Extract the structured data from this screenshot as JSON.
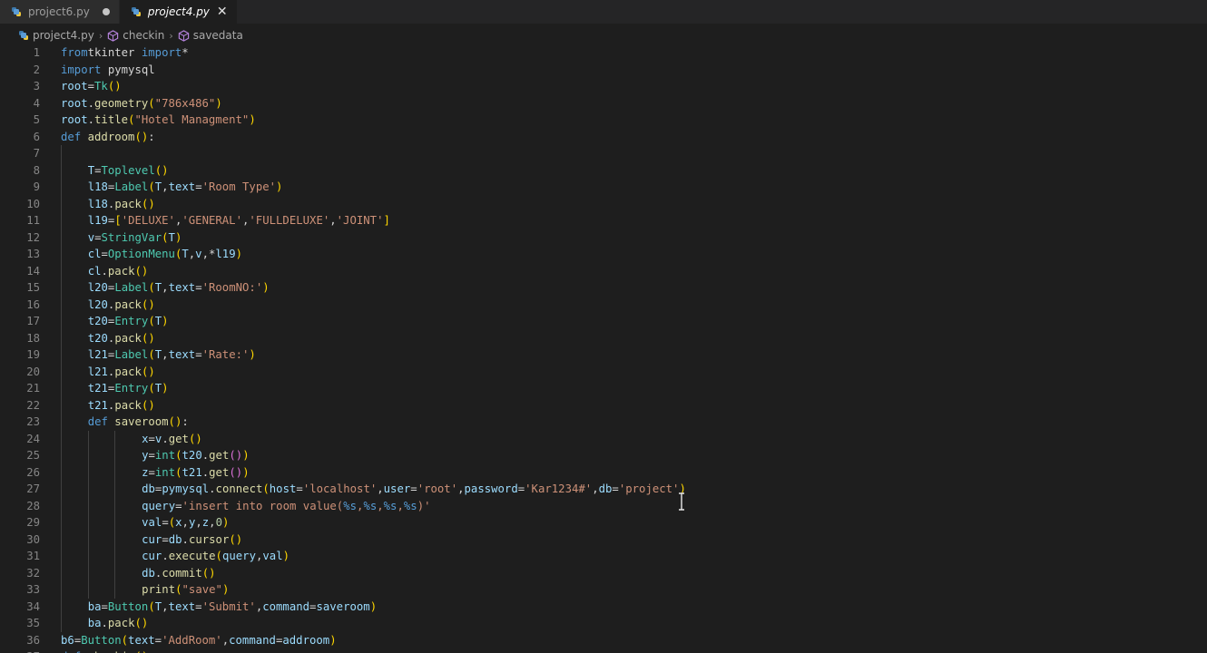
{
  "tabs": [
    {
      "label": "project6.py",
      "active": false,
      "modified": true
    },
    {
      "label": "project4.py",
      "active": true,
      "modified": false
    }
  ],
  "breadcrumb": {
    "file": "project4.py",
    "symbol1": "checkin",
    "symbol2": "savedata"
  },
  "colors": {
    "background": "#1e1e1e",
    "keyword": "#569cd6",
    "string": "#ce9178",
    "function": "#dcdcaa",
    "class": "#4ec9b0"
  },
  "editor": {
    "lines": [
      {
        "n": "1",
        "indent": 0,
        "tokens": [
          [
            "kw",
            "from"
          ],
          [
            "",
            "tkinter"
          ],
          [
            "kw",
            " import"
          ],
          [
            "",
            "*"
          ]
        ]
      },
      {
        "n": "2",
        "indent": 0,
        "tokens": [
          [
            "kw",
            "import"
          ],
          [
            "",
            " pymysql"
          ]
        ]
      },
      {
        "n": "3",
        "indent": 0,
        "tokens": [
          [
            "var",
            "root"
          ],
          [
            "",
            "="
          ],
          [
            "cls",
            "Tk"
          ],
          [
            "br1",
            "()"
          ]
        ]
      },
      {
        "n": "4",
        "indent": 0,
        "tokens": [
          [
            "var",
            "root"
          ],
          [
            "",
            "."
          ],
          [
            "fn",
            "geometry"
          ],
          [
            "br1",
            "("
          ],
          [
            "str",
            "\"786x486\""
          ],
          [
            "br1",
            ")"
          ]
        ]
      },
      {
        "n": "5",
        "indent": 0,
        "tokens": [
          [
            "var",
            "root"
          ],
          [
            "",
            "."
          ],
          [
            "fn",
            "title"
          ],
          [
            "br1",
            "("
          ],
          [
            "str",
            "\"Hotel Managment\""
          ],
          [
            "br1",
            ")"
          ]
        ]
      },
      {
        "n": "6",
        "indent": 0,
        "tokens": [
          [
            "kw",
            "def"
          ],
          [
            "fn",
            " addroom"
          ],
          [
            "br1",
            "()"
          ],
          [
            "",
            ":"
          ]
        ]
      },
      {
        "n": "7",
        "indent": 1,
        "tokens": []
      },
      {
        "n": "8",
        "indent": 1,
        "tokens": [
          [
            "var",
            "T"
          ],
          [
            "",
            "="
          ],
          [
            "cls",
            "Toplevel"
          ],
          [
            "br1",
            "()"
          ]
        ]
      },
      {
        "n": "9",
        "indent": 1,
        "tokens": [
          [
            "var",
            "l18"
          ],
          [
            "",
            "="
          ],
          [
            "cls",
            "Label"
          ],
          [
            "br1",
            "("
          ],
          [
            "var",
            "T"
          ],
          [
            "",
            ","
          ],
          [
            "var",
            "text"
          ],
          [
            "",
            "="
          ],
          [
            "str",
            "'Room Type'"
          ],
          [
            "br1",
            ")"
          ]
        ]
      },
      {
        "n": "10",
        "indent": 1,
        "tokens": [
          [
            "var",
            "l18"
          ],
          [
            "",
            "."
          ],
          [
            "fn",
            "pack"
          ],
          [
            "br1",
            "()"
          ]
        ]
      },
      {
        "n": "11",
        "indent": 1,
        "tokens": [
          [
            "var",
            "l19"
          ],
          [
            "",
            "="
          ],
          [
            "br1",
            "["
          ],
          [
            "str",
            "'DELUXE'"
          ],
          [
            "",
            ","
          ],
          [
            "str",
            "'GENERAL'"
          ],
          [
            "",
            ","
          ],
          [
            "str",
            "'FULLDELUXE'"
          ],
          [
            "",
            ","
          ],
          [
            "str",
            "'JOINT'"
          ],
          [
            "br1",
            "]"
          ]
        ]
      },
      {
        "n": "12",
        "indent": 1,
        "tokens": [
          [
            "var",
            "v"
          ],
          [
            "",
            "="
          ],
          [
            "cls",
            "StringVar"
          ],
          [
            "br1",
            "("
          ],
          [
            "var",
            "T"
          ],
          [
            "br1",
            ")"
          ]
        ]
      },
      {
        "n": "13",
        "indent": 1,
        "tokens": [
          [
            "var",
            "cl"
          ],
          [
            "",
            "="
          ],
          [
            "cls",
            "OptionMenu"
          ],
          [
            "br1",
            "("
          ],
          [
            "var",
            "T"
          ],
          [
            "",
            ","
          ],
          [
            "var",
            "v"
          ],
          [
            "",
            ",*"
          ],
          [
            "var",
            "l19"
          ],
          [
            "br1",
            ")"
          ]
        ]
      },
      {
        "n": "14",
        "indent": 1,
        "tokens": [
          [
            "var",
            "cl"
          ],
          [
            "",
            "."
          ],
          [
            "fn",
            "pack"
          ],
          [
            "br1",
            "()"
          ]
        ]
      },
      {
        "n": "15",
        "indent": 1,
        "tokens": [
          [
            "var",
            "l20"
          ],
          [
            "",
            "="
          ],
          [
            "cls",
            "Label"
          ],
          [
            "br1",
            "("
          ],
          [
            "var",
            "T"
          ],
          [
            "",
            ","
          ],
          [
            "var",
            "text"
          ],
          [
            "",
            "="
          ],
          [
            "str",
            "'RoomNO:'"
          ],
          [
            "br1",
            ")"
          ]
        ]
      },
      {
        "n": "16",
        "indent": 1,
        "tokens": [
          [
            "var",
            "l20"
          ],
          [
            "",
            "."
          ],
          [
            "fn",
            "pack"
          ],
          [
            "br1",
            "()"
          ]
        ]
      },
      {
        "n": "17",
        "indent": 1,
        "tokens": [
          [
            "var",
            "t20"
          ],
          [
            "",
            "="
          ],
          [
            "cls",
            "Entry"
          ],
          [
            "br1",
            "("
          ],
          [
            "var",
            "T"
          ],
          [
            "br1",
            ")"
          ]
        ]
      },
      {
        "n": "18",
        "indent": 1,
        "tokens": [
          [
            "var",
            "t20"
          ],
          [
            "",
            "."
          ],
          [
            "fn",
            "pack"
          ],
          [
            "br1",
            "()"
          ]
        ]
      },
      {
        "n": "19",
        "indent": 1,
        "tokens": [
          [
            "var",
            "l21"
          ],
          [
            "",
            "="
          ],
          [
            "cls",
            "Label"
          ],
          [
            "br1",
            "("
          ],
          [
            "var",
            "T"
          ],
          [
            "",
            ","
          ],
          [
            "var",
            "text"
          ],
          [
            "",
            "="
          ],
          [
            "str",
            "'Rate:'"
          ],
          [
            "br1",
            ")"
          ]
        ]
      },
      {
        "n": "20",
        "indent": 1,
        "tokens": [
          [
            "var",
            "l21"
          ],
          [
            "",
            "."
          ],
          [
            "fn",
            "pack"
          ],
          [
            "br1",
            "()"
          ]
        ]
      },
      {
        "n": "21",
        "indent": 1,
        "tokens": [
          [
            "var",
            "t21"
          ],
          [
            "",
            "="
          ],
          [
            "cls",
            "Entry"
          ],
          [
            "br1",
            "("
          ],
          [
            "var",
            "T"
          ],
          [
            "br1",
            ")"
          ]
        ]
      },
      {
        "n": "22",
        "indent": 1,
        "tokens": [
          [
            "var",
            "t21"
          ],
          [
            "",
            "."
          ],
          [
            "fn",
            "pack"
          ],
          [
            "br1",
            "()"
          ]
        ]
      },
      {
        "n": "23",
        "indent": 1,
        "tokens": [
          [
            "kw",
            "def"
          ],
          [
            "fn",
            " saveroom"
          ],
          [
            "br1",
            "()"
          ],
          [
            "",
            ":"
          ]
        ]
      },
      {
        "n": "24",
        "indent": 3,
        "tokens": [
          [
            "var",
            "x"
          ],
          [
            "",
            "="
          ],
          [
            "var",
            "v"
          ],
          [
            "",
            "."
          ],
          [
            "fn",
            "get"
          ],
          [
            "br1",
            "()"
          ]
        ]
      },
      {
        "n": "25",
        "indent": 3,
        "tokens": [
          [
            "var",
            "y"
          ],
          [
            "",
            "="
          ],
          [
            "cls",
            "int"
          ],
          [
            "br1",
            "("
          ],
          [
            "var",
            "t20"
          ],
          [
            "",
            "."
          ],
          [
            "fn",
            "get"
          ],
          [
            "br2",
            "()"
          ],
          [
            "br1",
            ")"
          ]
        ]
      },
      {
        "n": "26",
        "indent": 3,
        "tokens": [
          [
            "var",
            "z"
          ],
          [
            "",
            "="
          ],
          [
            "cls",
            "int"
          ],
          [
            "br1",
            "("
          ],
          [
            "var",
            "t21"
          ],
          [
            "",
            "."
          ],
          [
            "fn",
            "get"
          ],
          [
            "br2",
            "()"
          ],
          [
            "br1",
            ")"
          ]
        ]
      },
      {
        "n": "27",
        "indent": 3,
        "tokens": [
          [
            "var",
            "db"
          ],
          [
            "",
            "="
          ],
          [
            "var",
            "pymysql"
          ],
          [
            "",
            "."
          ],
          [
            "fn",
            "connect"
          ],
          [
            "br1",
            "("
          ],
          [
            "var",
            "host"
          ],
          [
            "",
            "="
          ],
          [
            "str",
            "'localhost'"
          ],
          [
            "",
            ","
          ],
          [
            "var",
            "user"
          ],
          [
            "",
            "="
          ],
          [
            "str",
            "'root'"
          ],
          [
            "",
            ","
          ],
          [
            "var",
            "password"
          ],
          [
            "",
            "="
          ],
          [
            "str",
            "'Kar1234#'"
          ],
          [
            "",
            ","
          ],
          [
            "var",
            "db"
          ],
          [
            "",
            "="
          ],
          [
            "str",
            "'project'"
          ],
          [
            "br1",
            ")"
          ]
        ]
      },
      {
        "n": "28",
        "indent": 3,
        "tokens": [
          [
            "var",
            "query"
          ],
          [
            "",
            "="
          ],
          [
            "str",
            "'insert into room value("
          ],
          [
            "kw",
            "%s"
          ],
          [
            "str",
            ","
          ],
          [
            "kw",
            "%s"
          ],
          [
            "str",
            ","
          ],
          [
            "kw",
            "%s"
          ],
          [
            "str",
            ","
          ],
          [
            "kw",
            "%s"
          ],
          [
            "str",
            ")'"
          ]
        ]
      },
      {
        "n": "29",
        "indent": 3,
        "tokens": [
          [
            "var",
            "val"
          ],
          [
            "",
            "="
          ],
          [
            "br1",
            "("
          ],
          [
            "var",
            "x"
          ],
          [
            "",
            ","
          ],
          [
            "var",
            "y"
          ],
          [
            "",
            ","
          ],
          [
            "var",
            "z"
          ],
          [
            "",
            ","
          ],
          [
            "num",
            "0"
          ],
          [
            "br1",
            ")"
          ]
        ]
      },
      {
        "n": "30",
        "indent": 3,
        "tokens": [
          [
            "var",
            "cur"
          ],
          [
            "",
            "="
          ],
          [
            "var",
            "db"
          ],
          [
            "",
            "."
          ],
          [
            "fn",
            "cursor"
          ],
          [
            "br1",
            "()"
          ]
        ]
      },
      {
        "n": "31",
        "indent": 3,
        "tokens": [
          [
            "var",
            "cur"
          ],
          [
            "",
            "."
          ],
          [
            "fn",
            "execute"
          ],
          [
            "br1",
            "("
          ],
          [
            "var",
            "query"
          ],
          [
            "",
            ","
          ],
          [
            "var",
            "val"
          ],
          [
            "br1",
            ")"
          ]
        ]
      },
      {
        "n": "32",
        "indent": 3,
        "tokens": [
          [
            "var",
            "db"
          ],
          [
            "",
            "."
          ],
          [
            "fn",
            "commit"
          ],
          [
            "br1",
            "()"
          ]
        ]
      },
      {
        "n": "33",
        "indent": 3,
        "tokens": [
          [
            "fn",
            "print"
          ],
          [
            "br1",
            "("
          ],
          [
            "str",
            "\"save\""
          ],
          [
            "br1",
            ")"
          ]
        ]
      },
      {
        "n": "34",
        "indent": 1,
        "tokens": [
          [
            "var",
            "ba"
          ],
          [
            "",
            "="
          ],
          [
            "cls",
            "Button"
          ],
          [
            "br1",
            "("
          ],
          [
            "var",
            "T"
          ],
          [
            "",
            ","
          ],
          [
            "var",
            "text"
          ],
          [
            "",
            "="
          ],
          [
            "str",
            "'Submit'"
          ],
          [
            "",
            ","
          ],
          [
            "var",
            "command"
          ],
          [
            "",
            "="
          ],
          [
            "var",
            "saveroom"
          ],
          [
            "br1",
            ")"
          ]
        ]
      },
      {
        "n": "35",
        "indent": 1,
        "tokens": [
          [
            "var",
            "ba"
          ],
          [
            "",
            "."
          ],
          [
            "fn",
            "pack"
          ],
          [
            "br1",
            "()"
          ]
        ]
      },
      {
        "n": "36",
        "indent": 0,
        "tokens": [
          [
            "var",
            "b6"
          ],
          [
            "",
            "="
          ],
          [
            "cls",
            "Button"
          ],
          [
            "br1",
            "("
          ],
          [
            "var",
            "text"
          ],
          [
            "",
            "="
          ],
          [
            "str",
            "'AddRoom'"
          ],
          [
            "",
            ","
          ],
          [
            "var",
            "command"
          ],
          [
            "",
            "="
          ],
          [
            "var",
            "addroom"
          ],
          [
            "br1",
            ")"
          ]
        ]
      },
      {
        "n": "37",
        "indent": 0,
        "tokens": [
          [
            "kw",
            "def"
          ],
          [
            "fn",
            " checkin"
          ],
          [
            "br1",
            "()"
          ],
          [
            "",
            ":"
          ]
        ]
      }
    ]
  }
}
